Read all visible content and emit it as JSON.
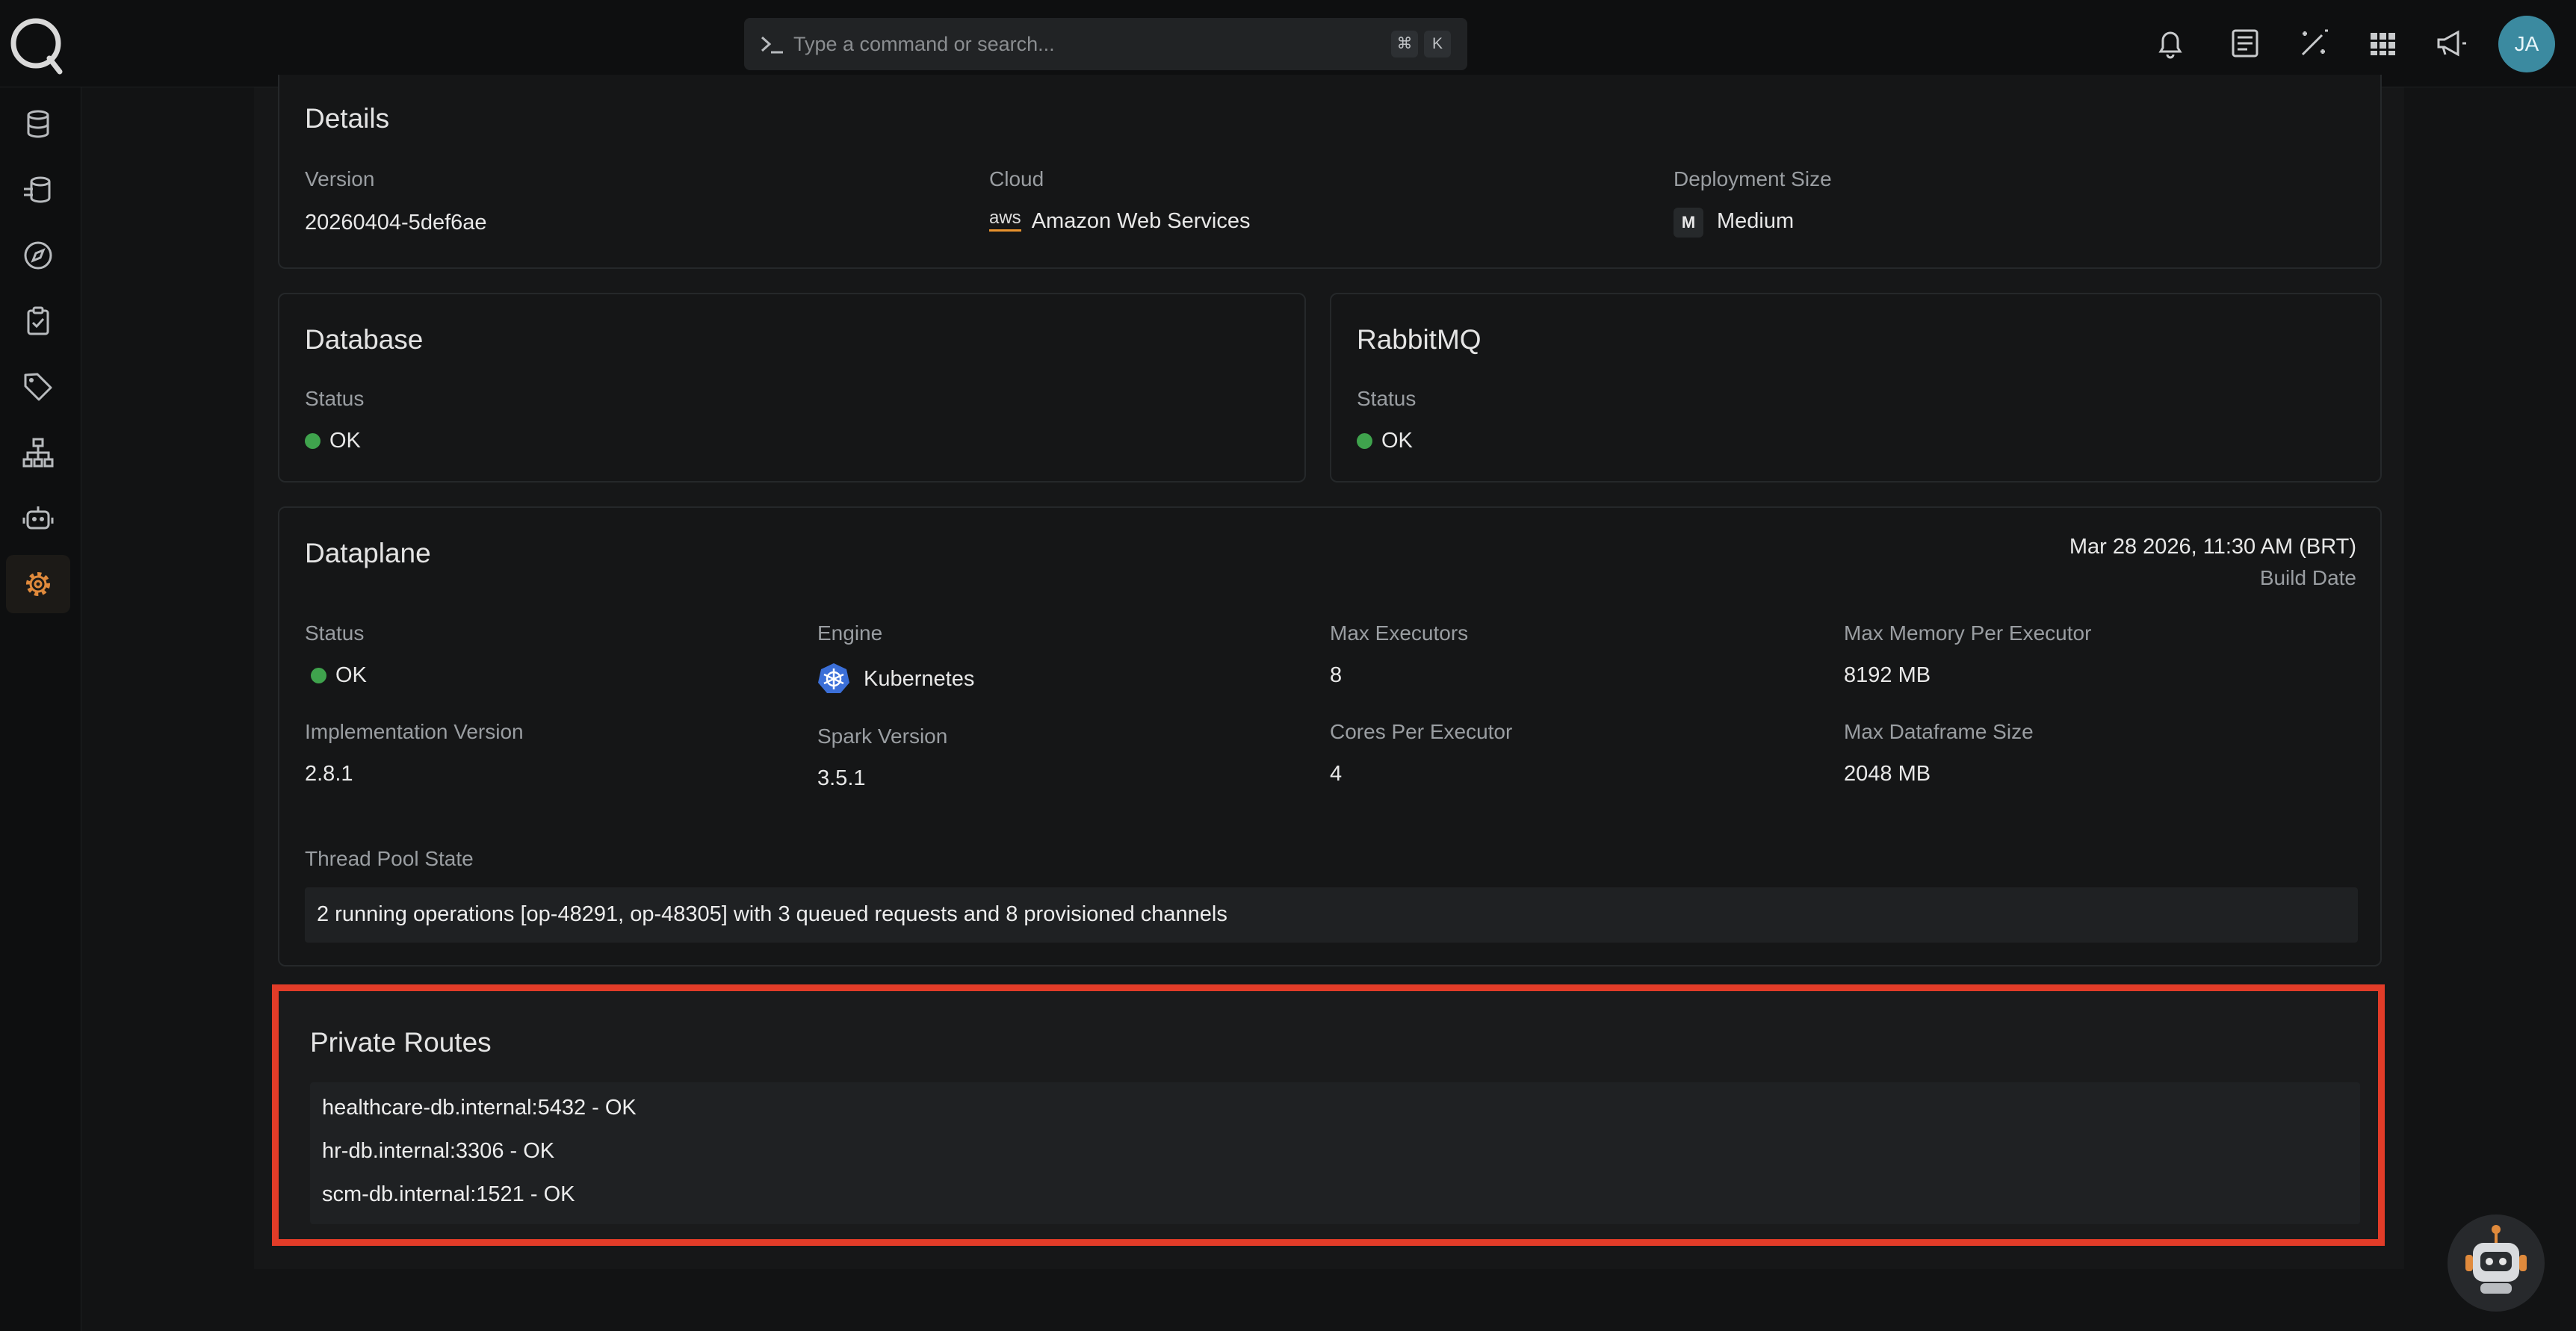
{
  "search": {
    "placeholder": "Type a command or search...",
    "shortcut_mod": "⌘",
    "shortcut_key": "K"
  },
  "user": {
    "initials": "JA"
  },
  "details": {
    "title": "Details",
    "version_label": "Version",
    "version_value": "20260404-5def6ae",
    "cloud_label": "Cloud",
    "cloud_value": "Amazon Web Services",
    "cloud_logo": "aws",
    "size_label": "Deployment Size",
    "size_value": "Medium",
    "size_badge": "M"
  },
  "database": {
    "title": "Database",
    "status_label": "Status",
    "status_value": "OK"
  },
  "rabbitmq": {
    "title": "RabbitMQ",
    "status_label": "Status",
    "status_value": "OK"
  },
  "dataplane": {
    "title": "Dataplane",
    "build_date": "Mar 28 2026, 11:30 AM (BRT)",
    "build_date_label": "Build Date",
    "status_label": "Status",
    "status_value": "OK",
    "engine_label": "Engine",
    "engine_value": "Kubernetes",
    "max_exec_label": "Max Executors",
    "max_exec_value": "8",
    "max_mem_label": "Max Memory Per Executor",
    "max_mem_value": "8192 MB",
    "impl_label": "Implementation Version",
    "impl_value": "2.8.1",
    "spark_label": "Spark Version",
    "spark_value": "3.5.1",
    "cores_label": "Cores Per Executor",
    "cores_value": "4",
    "max_df_label": "Max Dataframe Size",
    "max_df_value": "2048 MB",
    "thread_label": "Thread Pool State",
    "thread_value": "2 running operations [op-48291, op-48305] with 3 queued requests and 8 provisioned channels"
  },
  "private_routes": {
    "title": "Private Routes",
    "routes": [
      "healthcare-db.internal:5432 - OK",
      "hr-db.internal:3306 - OK",
      "scm-db.internal:1521 - OK"
    ]
  },
  "colors": {
    "ok": "#3fa34d",
    "highlight": "#e23c28",
    "accent": "#e08a3c",
    "avatar": "#3b8aa0"
  }
}
